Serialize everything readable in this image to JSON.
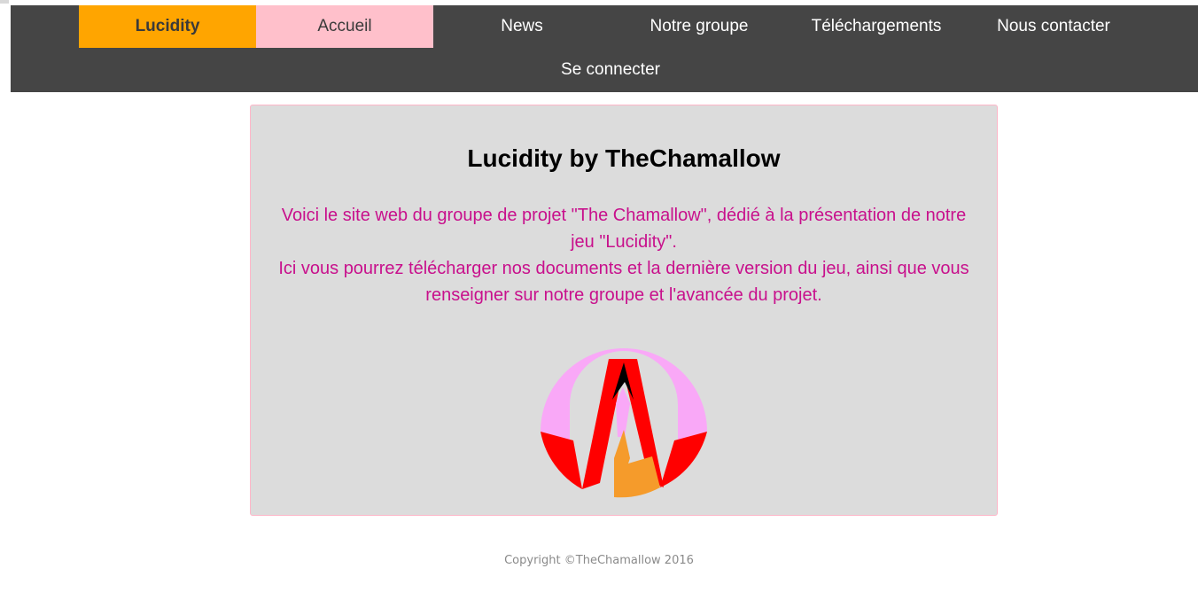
{
  "nav": {
    "brand": "Lucidity",
    "items": [
      "Accueil",
      "News",
      "Notre groupe",
      "Téléchargements",
      "Nous contacter",
      "Se connecter"
    ]
  },
  "main": {
    "title": "Lucidity by TheChamallow",
    "paragraph_1": "Voici le site web du groupe de projet \"The Chamallow\", dédié à la présentation de notre jeu \"Lucidity\".",
    "paragraph_2": "Ici vous pourrez télécharger nos documents et la dernière version du jeu, ainsi que vous renseigner sur notre groupe et l'avancée du projet."
  },
  "footer": {
    "copyright": "Copyright ©TheChamallow 2016"
  },
  "colors": {
    "navbar": "#454545",
    "brand_bg": "#ffa500",
    "active_bg": "#ffc0cb",
    "content_bg": "#dcdcdc",
    "intro_text": "#c8108c"
  }
}
